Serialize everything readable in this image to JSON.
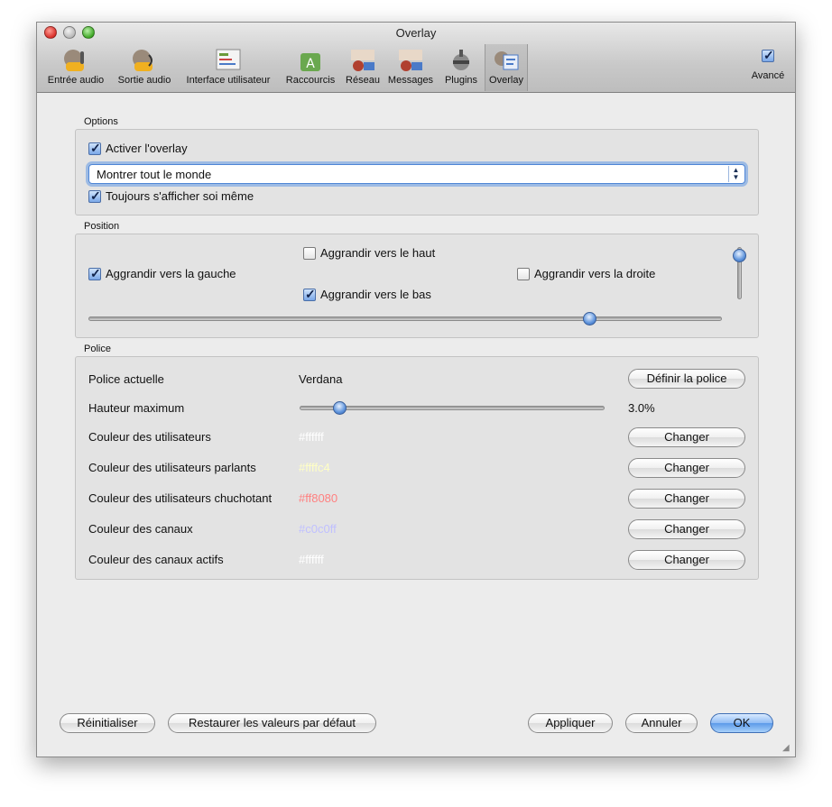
{
  "window": {
    "title": "Overlay"
  },
  "toolbar": {
    "items": [
      {
        "label": "Entrée audio",
        "icon": "microphone-input-icon"
      },
      {
        "label": "Sortie audio",
        "icon": "speaker-output-icon"
      },
      {
        "label": "Interface utilisateur",
        "icon": "user-interface-icon"
      },
      {
        "label": "Raccourcis",
        "icon": "shortcuts-icon"
      },
      {
        "label": "Réseau",
        "icon": "network-icon"
      },
      {
        "label": "Messages",
        "icon": "messages-icon"
      },
      {
        "label": "Plugins",
        "icon": "plugins-icon"
      },
      {
        "label": "Overlay",
        "icon": "overlay-icon",
        "selected": true
      }
    ],
    "advanced": {
      "label": "Avancé",
      "checked": true
    }
  },
  "options": {
    "section_label": "Options",
    "enable_overlay": {
      "label": "Activer l'overlay",
      "checked": true
    },
    "show_select": {
      "value": "Montrer tout le monde"
    },
    "always_self": {
      "label": "Toujours s'afficher soi même",
      "checked": true
    }
  },
  "position": {
    "section_label": "Position",
    "grow_up": {
      "label": "Aggrandir vers le haut",
      "checked": false
    },
    "grow_left": {
      "label": "Aggrandir vers la gauche",
      "checked": true
    },
    "grow_right": {
      "label": "Aggrandir vers la droite",
      "checked": false
    },
    "grow_down": {
      "label": "Aggrandir vers le bas",
      "checked": true
    },
    "horizontal_slider": 0.79,
    "vertical_slider": 0.0
  },
  "font": {
    "section_label": "Police",
    "current_label": "Police actuelle",
    "current_value": "Verdana",
    "set_font_button": "Définir la police",
    "max_height_label": "Hauteur maximum",
    "max_height_slider": 0.13,
    "max_height_value": "3.0%",
    "colors": [
      {
        "label": "Couleur des utilisateurs",
        "value": "#ffffff",
        "button": "Changer"
      },
      {
        "label": "Couleur des utilisateurs parlants",
        "value": "#ffffc4",
        "button": "Changer"
      },
      {
        "label": "Couleur des utilisateurs chuchotant",
        "value": "#ff8080",
        "button": "Changer"
      },
      {
        "label": "Couleur des canaux",
        "value": "#c0c0ff",
        "button": "Changer"
      },
      {
        "label": "Couleur des canaux actifs",
        "value": "#ffffff",
        "button": "Changer"
      }
    ]
  },
  "footer": {
    "reset": "Réinitialiser",
    "restore_defaults": "Restaurer les valeurs par défaut",
    "apply": "Appliquer",
    "cancel": "Annuler",
    "ok": "OK"
  }
}
